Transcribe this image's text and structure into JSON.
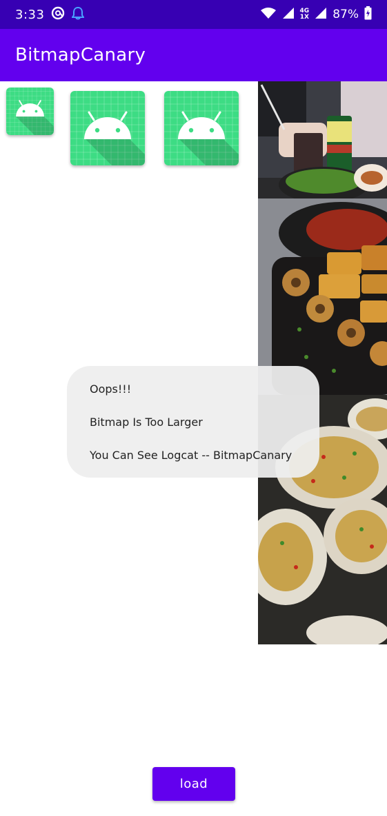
{
  "status_bar": {
    "time": "3:33",
    "network": "4G",
    "network_sub": "1X",
    "battery": "87%",
    "icons": [
      "at-sign-icon",
      "notification-bell-icon",
      "wifi-icon",
      "signal-icon",
      "battery-charging-icon"
    ]
  },
  "app_bar": {
    "title": "BitmapCanary"
  },
  "icons": {
    "name": "android-launcher-icon",
    "background_color": "#3ddc84"
  },
  "toast": {
    "lines": [
      "Oops!!!",
      "Bitmap Is Too Larger",
      "You Can See Logcat -- BitmapCanary"
    ]
  },
  "load_button": {
    "label": "load"
  },
  "colors": {
    "status_bar": "#3700b3",
    "primary": "#6200ee",
    "toast_bg": "#eeeeee"
  }
}
